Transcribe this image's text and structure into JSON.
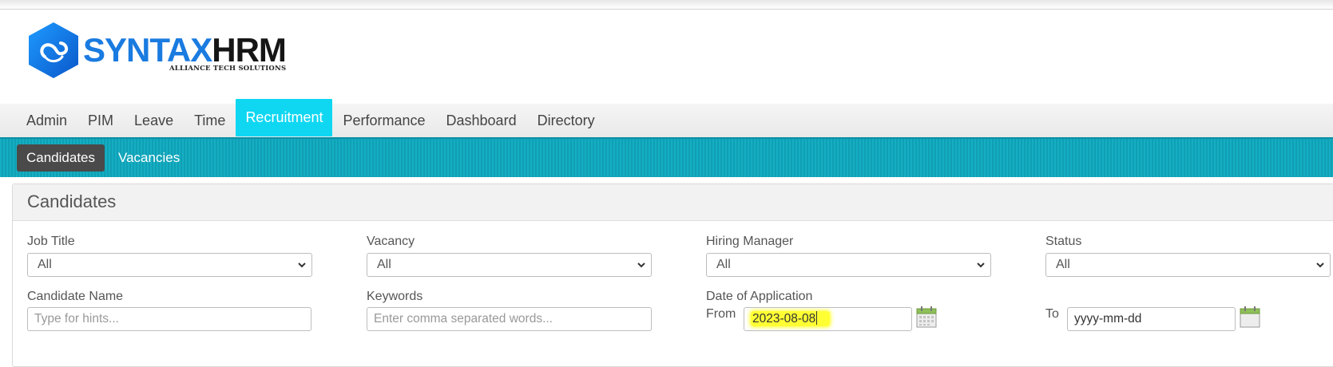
{
  "logo": {
    "word_blue": "SYNTAX",
    "word_dark": "HRM",
    "tagline": "ALLIANCE TECH SOLUTIONS"
  },
  "main_nav": [
    {
      "label": "Admin",
      "active": false
    },
    {
      "label": "PIM",
      "active": false
    },
    {
      "label": "Leave",
      "active": false
    },
    {
      "label": "Time",
      "active": false
    },
    {
      "label": "Recruitment",
      "active": true
    },
    {
      "label": "Performance",
      "active": false
    },
    {
      "label": "Dashboard",
      "active": false
    },
    {
      "label": "Directory",
      "active": false
    }
  ],
  "sub_nav": [
    {
      "label": "Candidates",
      "active": true
    },
    {
      "label": "Vacancies",
      "active": false
    }
  ],
  "panel": {
    "title": "Candidates",
    "job_title": {
      "label": "Job Title",
      "value": "All"
    },
    "vacancy": {
      "label": "Vacancy",
      "value": "All"
    },
    "hiring_manager": {
      "label": "Hiring Manager",
      "value": "All"
    },
    "status": {
      "label": "Status",
      "value": "All"
    },
    "candidate_name": {
      "label": "Candidate Name",
      "placeholder": "Type for hints..."
    },
    "keywords": {
      "label": "Keywords",
      "placeholder": "Enter comma separated words..."
    },
    "date_of_application": {
      "label": "Date of Application",
      "from_label": "From",
      "from_value": "2023-08-08",
      "to_label": "To",
      "to_placeholder": "yyyy-mm-dd"
    }
  },
  "colors": {
    "accent_cyan": "#0fd7f2",
    "subnav_teal": "#15aec3",
    "logo_blue": "#1a7be0",
    "highlight_yellow": "#ffff33"
  },
  "icons": [
    "logo-hexagon-icon",
    "chevron-down-icon",
    "calendar-icon"
  ]
}
